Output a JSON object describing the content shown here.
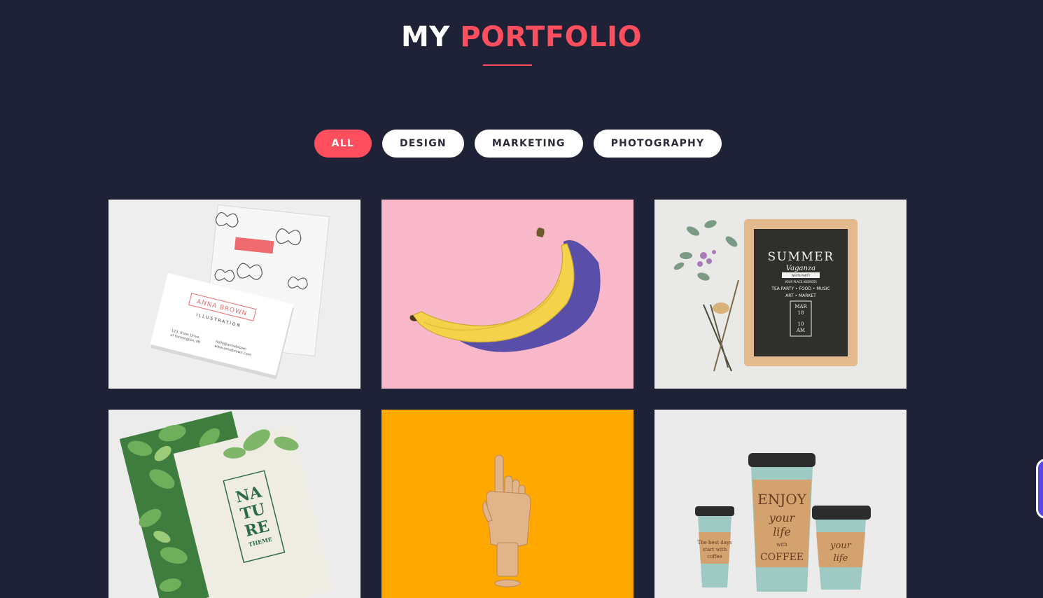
{
  "header": {
    "title_word1": "MY",
    "title_word2": "PORTFOLIO",
    "accent_color": "#ff4f5e"
  },
  "filters": [
    {
      "label": "ALL",
      "active": true
    },
    {
      "label": "DESIGN",
      "active": false
    },
    {
      "label": "MARKETING",
      "active": false
    },
    {
      "label": "PHOTOGRAPHY",
      "active": false
    }
  ],
  "portfolio": {
    "items": [
      {
        "subject": "business cards with butterflies",
        "card_name": "ANNA BROWN",
        "card_role": "ILLUSTRATION",
        "card_address": "123, River Drive\nof Farmington, MI",
        "card_contact": "hello@annabrown\nwww.annabrown.com"
      },
      {
        "subject": "banana on pink background"
      },
      {
        "subject": "summer chalkboard sign with flowers",
        "sign_title": "SUMMER",
        "sign_script": "Vaganza",
        "sign_ribbon": "WHITE PARTY",
        "sign_address": "YOUR PLACE ADDRESS",
        "sign_line1": "TEA PARTY • FOOD • MUSIC",
        "sign_line2": "ART • MARKET",
        "sign_date1": "MAR",
        "sign_date2": "18",
        "sign_time1": "10",
        "sign_time2": "AM"
      },
      {
        "subject": "nature theme cards with leaves",
        "text1": "NA",
        "text2": "TU",
        "text3": "RE",
        "text4": "THEME"
      },
      {
        "subject": "wooden hand on orange background"
      },
      {
        "subject": "coffee cups enjoy your life",
        "cup_main1": "ENJOY",
        "cup_main2": "your",
        "cup_main3": "life",
        "cup_main4": "with",
        "cup_main5": "COFFEE",
        "cup_left1": "The best days",
        "cup_left2": "start with",
        "cup_left3": "coffee",
        "cup_right1": "your",
        "cup_right2": "life"
      }
    ]
  }
}
